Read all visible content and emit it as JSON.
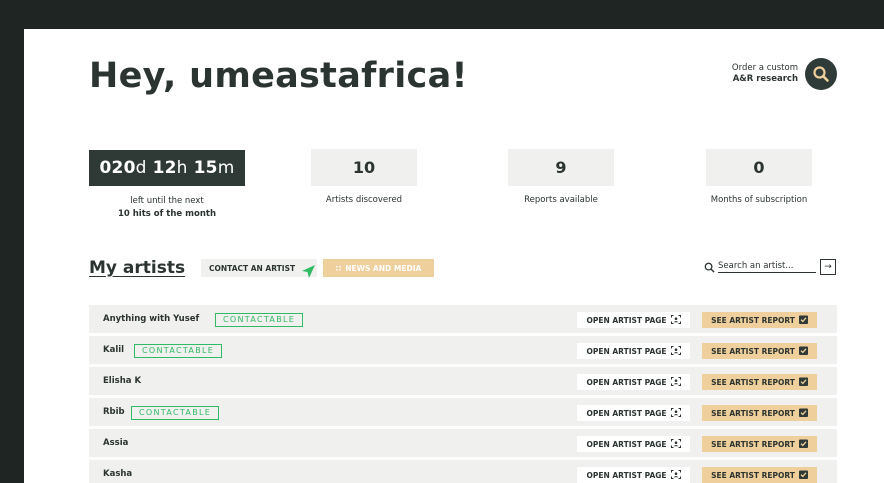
{
  "header": {
    "greeting": "Hey, umeastafrica!",
    "order_line1": "Order a custom",
    "order_line2": "A&R research"
  },
  "countdown": {
    "days": "020",
    "days_unit": "d",
    "hours": "12",
    "hours_unit": "h",
    "minutes": "15",
    "minutes_unit": "m",
    "caption_line1": "left until the next",
    "caption_line2": "10 hits of the month"
  },
  "stats": [
    {
      "value": "10",
      "label": "Artists discovered"
    },
    {
      "value": "9",
      "label": "Reports available"
    },
    {
      "value": "0",
      "label": "Months of subscription"
    }
  ],
  "section": {
    "title": "My artists",
    "contact_label": "CONTACT AN ARTIST",
    "news_label": "NEWS AND MEDIA",
    "search_placeholder": "Search an artist...",
    "search_go": "→"
  },
  "row_labels": {
    "contactable": "CONTACTABLE",
    "open_page": "OPEN ARTIST PAGE",
    "see_report": "SEE ARTIST REPORT"
  },
  "artists": [
    {
      "name": "Anything with Yusef",
      "contactable": true
    },
    {
      "name": "Kalil",
      "contactable": true
    },
    {
      "name": "Elisha K",
      "contactable": false
    },
    {
      "name": "Rbib",
      "contactable": true
    },
    {
      "name": "Assia",
      "contactable": false
    },
    {
      "name": "Kasha",
      "contactable": false
    }
  ],
  "colors": {
    "background": "#1f2523",
    "dark": "#2f3a37",
    "accent_orange": "#efcf9b",
    "contactable_green": "#2fba63"
  }
}
